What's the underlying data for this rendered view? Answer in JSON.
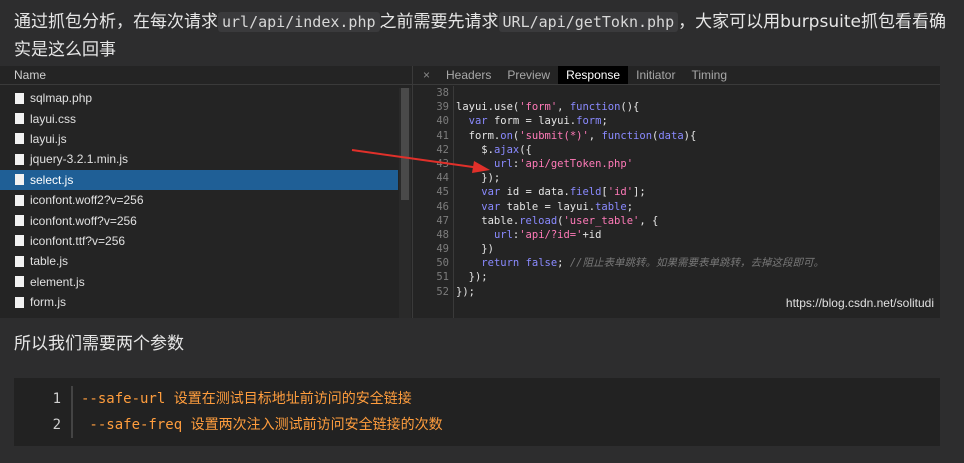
{
  "intro": {
    "t1": "通过抓包分析，在每次请求",
    "code1": "url/api/index.php",
    "t2": "之前需要先请求",
    "code2": "URL/api/getTokn.php",
    "t3": "，大家可以用burpsuite抓包看看确实是这么回事"
  },
  "devtools": {
    "name_header": "Name",
    "files": [
      "sqlmap.php",
      "layui.css",
      "layui.js",
      "jquery-3.2.1.min.js",
      "select.js",
      "iconfont.woff2?v=256",
      "iconfont.woff?v=256",
      "iconfont.ttf?v=256",
      "table.js",
      "element.js",
      "form.js"
    ],
    "selected_file": "select.js",
    "tabs": [
      "Headers",
      "Preview",
      "Response",
      "Initiator",
      "Timing"
    ],
    "active_tab": "Response",
    "close_glyph": "×",
    "line_numbers": [
      "38",
      "39",
      "40",
      "41",
      "42",
      "43",
      "44",
      "45",
      "46",
      "47",
      "48",
      "49",
      "50",
      "51",
      "52"
    ],
    "watermark": "https://blog.csdn.net/solitudi"
  },
  "para2": "所以我们需要两个参数",
  "codeblock": {
    "lines": [
      {
        "num": "1",
        "text": "--safe-url 设置在测试目标地址前访问的安全链接"
      },
      {
        "num": "2",
        "text": " --safe-freq 设置两次注入测试前访问安全链接的次数"
      }
    ]
  },
  "colors": {
    "selected_row": "#1f5f96",
    "keyword": "#8a8aff",
    "string": "#ff7ab8",
    "option": "#ff9d3d",
    "arrow": "#e0302a"
  }
}
